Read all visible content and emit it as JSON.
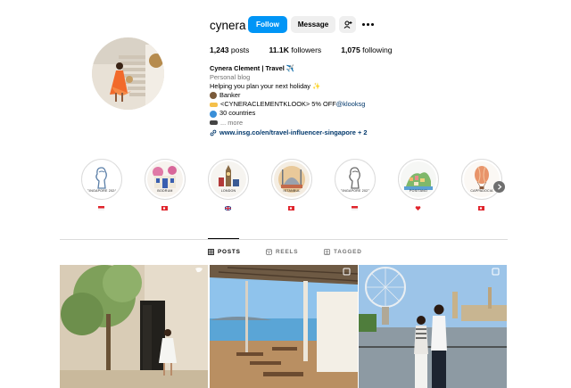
{
  "profile": {
    "username": "cynera",
    "follow_label": "Follow",
    "message_label": "Message",
    "add_user_icon": "add-user-icon",
    "more_icon": "more-horizontal-icon",
    "stats": {
      "posts": "1,243",
      "posts_label": "posts",
      "followers": "11.1K",
      "followers_label": "followers",
      "following": "1,075",
      "following_label": "following"
    },
    "bio": {
      "name": "Cynera Clement | Travel ✈️",
      "category": "Personal blog",
      "line1": "Helping you plan your next holiday ✨",
      "line2": "Banker",
      "line3_prefix": "<CYNERACLEMENTKLOOK> 5% OFF ",
      "line3_handle": "@klooksg",
      "line4": "30 countries",
      "line5": "... more",
      "link": "www.insg.co/en/travel-influencer-singapore + 2"
    }
  },
  "highlights": [
    {
      "caption": "SINGAPORE 2024",
      "icon": "merlion-icon"
    },
    {
      "caption": "BODRUM",
      "icon": "bodrum-street-icon"
    },
    {
      "caption": "LONDON",
      "icon": "big-ben-icon"
    },
    {
      "caption": "ISTANBUL",
      "icon": "mosque-icon"
    },
    {
      "caption": "SINGAPORE 2023",
      "icon": "merlion-icon"
    },
    {
      "caption": "POSITANO",
      "icon": "positano-icon"
    },
    {
      "caption": "CAPPADOCIA",
      "icon": "hot-air-balloon-icon"
    }
  ],
  "tabs": [
    {
      "label": "POSTS",
      "icon": "grid-icon",
      "active": true
    },
    {
      "label": "REELS",
      "icon": "reels-icon",
      "active": false
    },
    {
      "label": "TAGGED",
      "icon": "tagged-icon",
      "active": false
    }
  ],
  "colors": {
    "accent": "#0095f6",
    "link": "#00376b",
    "secondary_text": "#737373",
    "button_gray": "#efefef"
  }
}
